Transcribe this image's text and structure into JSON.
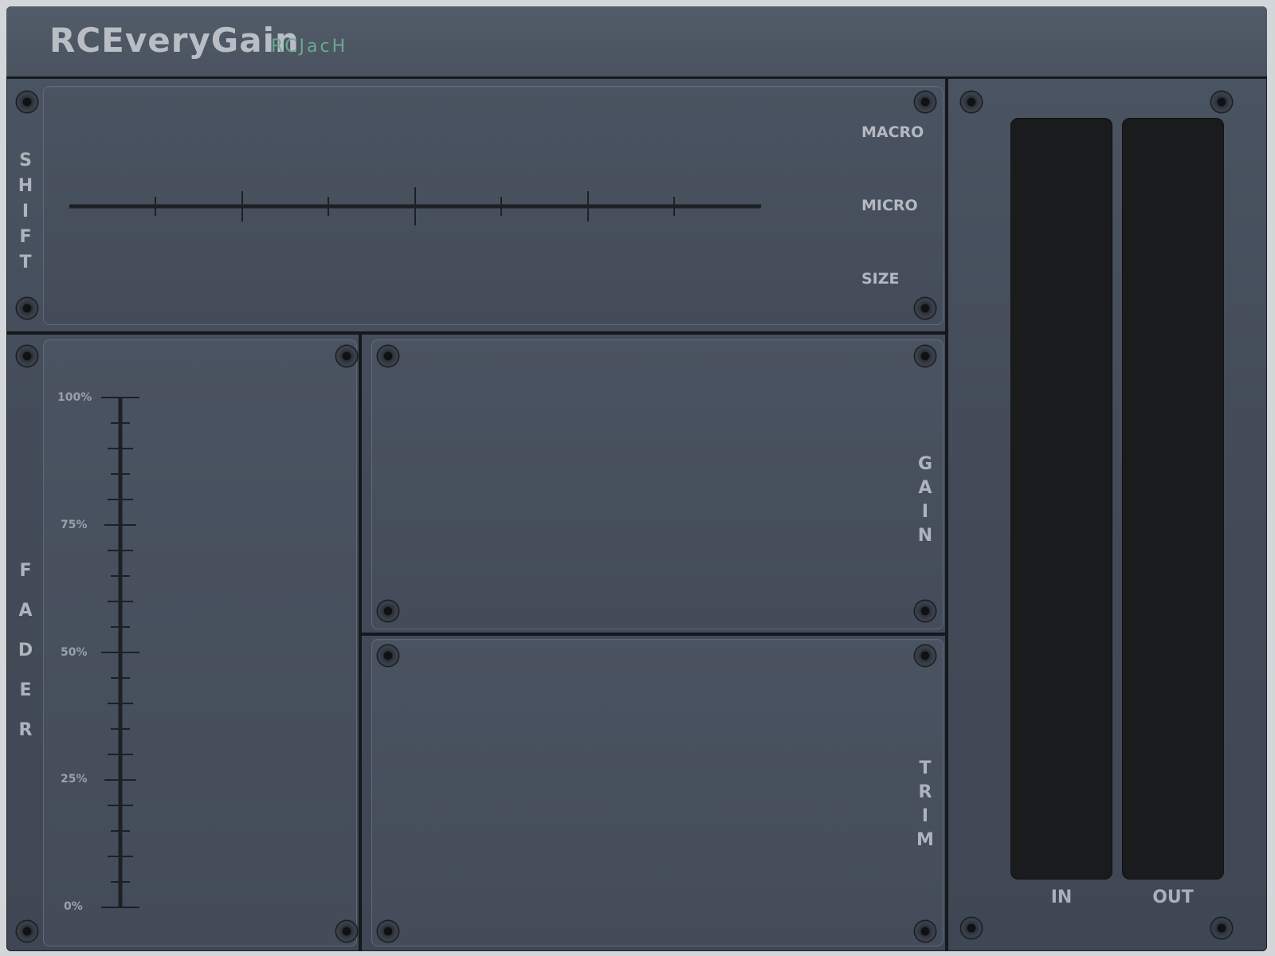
{
  "header": {
    "title": "RCEveryGain",
    "subtitle": "RCJacH"
  },
  "shift": {
    "label": "SHIFT",
    "letters": [
      "S",
      "H",
      "I",
      "F",
      "T"
    ],
    "options": [
      "MACRO",
      "MICRO",
      "SIZE"
    ]
  },
  "fader": {
    "label": "FADER",
    "letters": [
      "F",
      "A",
      "D",
      "E",
      "R"
    ],
    "scale": [
      "100%",
      "75%",
      "50%",
      "25%",
      "0%"
    ]
  },
  "gain": {
    "label": "GAIN",
    "letters": [
      "G",
      "A",
      "I",
      "N"
    ]
  },
  "trim": {
    "label": "TRIM",
    "letters": [
      "T",
      "R",
      "I",
      "M"
    ]
  },
  "meters": {
    "in_label": "IN",
    "out_label": "OUT"
  }
}
